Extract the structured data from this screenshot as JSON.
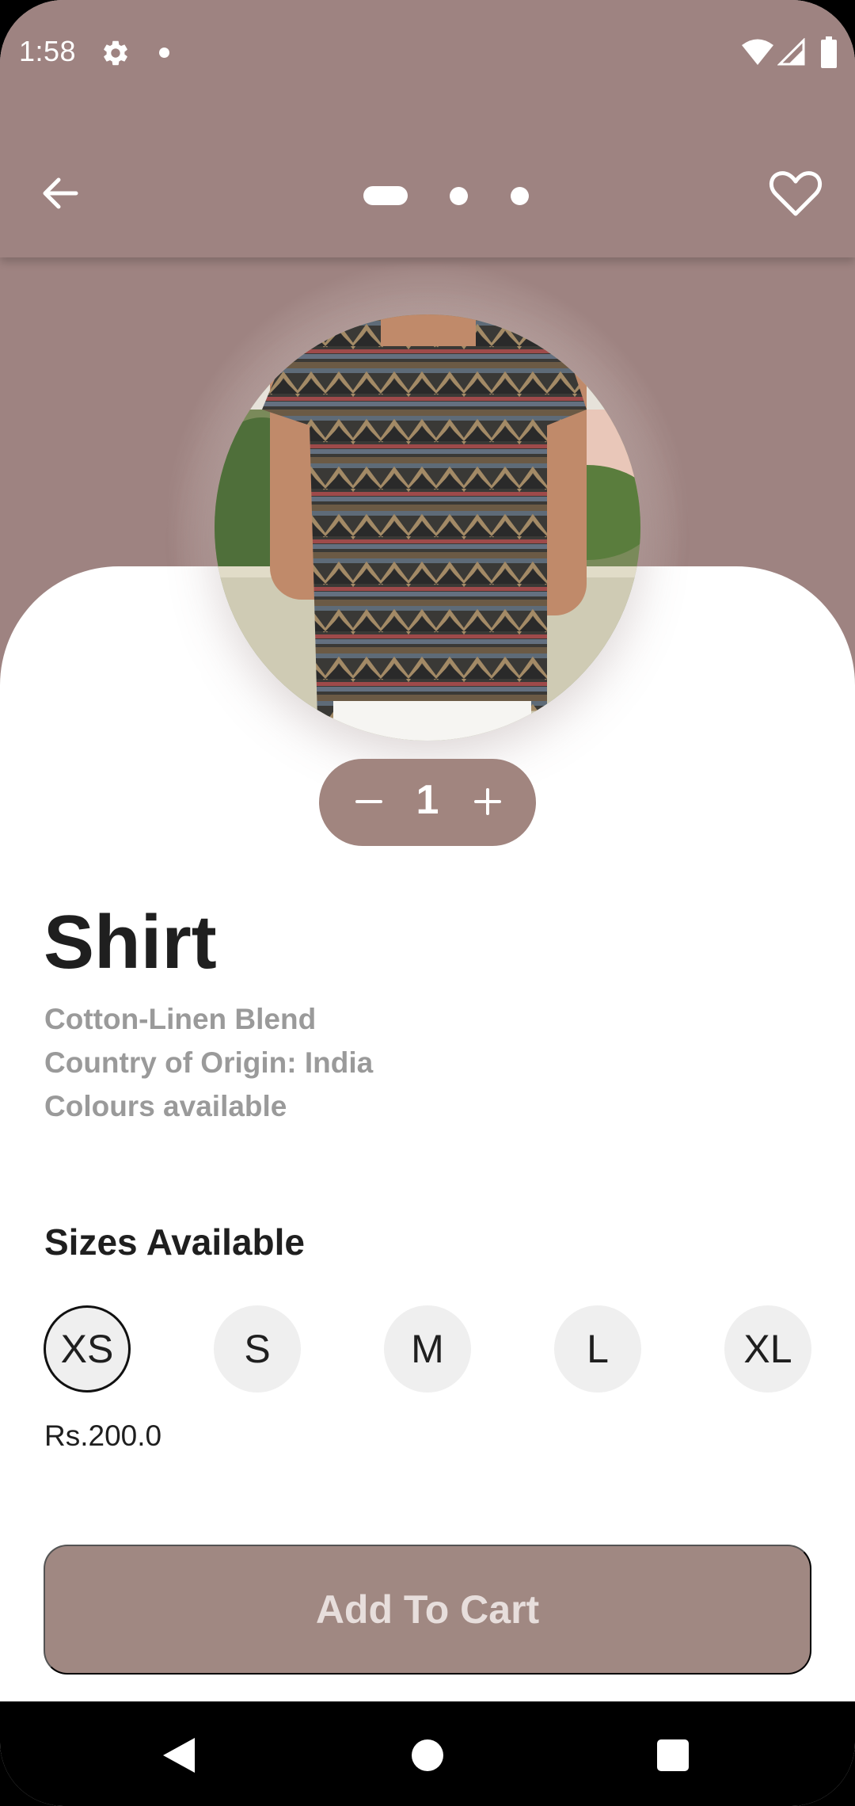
{
  "status_bar": {
    "time": "1:58",
    "icons": [
      "gear-icon",
      "notification-dot-icon",
      "wifi-icon",
      "cell-signal-icon",
      "battery-icon"
    ]
  },
  "app_bar": {
    "back_icon": "arrow-left-icon",
    "favorite_icon": "heart-outline-icon",
    "pager": {
      "count": 3,
      "active_index": 0
    }
  },
  "product": {
    "image_alt": "Shirt",
    "title": "Shirt",
    "description": [
      "Cotton-Linen Blend",
      "Country of Origin: India",
      "Colours available"
    ],
    "quantity": "1"
  },
  "sizes": {
    "heading": "Sizes Available",
    "options": [
      "XS",
      "S",
      "M",
      "L",
      "XL"
    ],
    "selected": "XS"
  },
  "price": "Rs.200.0",
  "add_to_cart_label": "Add To Cart",
  "colors": {
    "accent": "#9e8381",
    "button": "#a08882",
    "button_text": "#e7dedc"
  },
  "nav_bar": {
    "icons": [
      "nav-back-icon",
      "nav-home-icon",
      "nav-recents-icon"
    ]
  }
}
